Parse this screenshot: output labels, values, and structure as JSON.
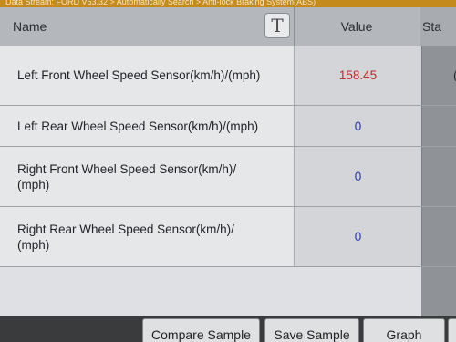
{
  "breadcrumb": "Data Stream: FORD V63.32 > Automatically Search > Anti-lock Braking System(ABS)",
  "columns": {
    "name": "Name",
    "value": "Value",
    "status": "Sta"
  },
  "toolbar": {
    "text_size_icon_glyph": "T"
  },
  "rows": [
    {
      "name": "Left Front Wheel Speed Sensor(km/h)/(mph)",
      "value": "158.45",
      "status": "("
    },
    {
      "name": "Left Rear Wheel Speed Sensor(km/h)/(mph)",
      "value": "0",
      "status": ""
    },
    {
      "name": "Right Front Wheel Speed Sensor(km/h)/\n(mph)",
      "value": "0",
      "status": ""
    },
    {
      "name": "Right Rear Wheel Speed Sensor(km/h)/\n(mph)",
      "value": "0",
      "status": ""
    }
  ],
  "buttons": {
    "compare_sample": "Compare Sample",
    "save_sample": "Save Sample",
    "graph": "Graph"
  },
  "colors": {
    "highlight_value": "#c0282a",
    "normal_value": "#2639a8",
    "breadcrumb_bar": "#c58a1c"
  }
}
